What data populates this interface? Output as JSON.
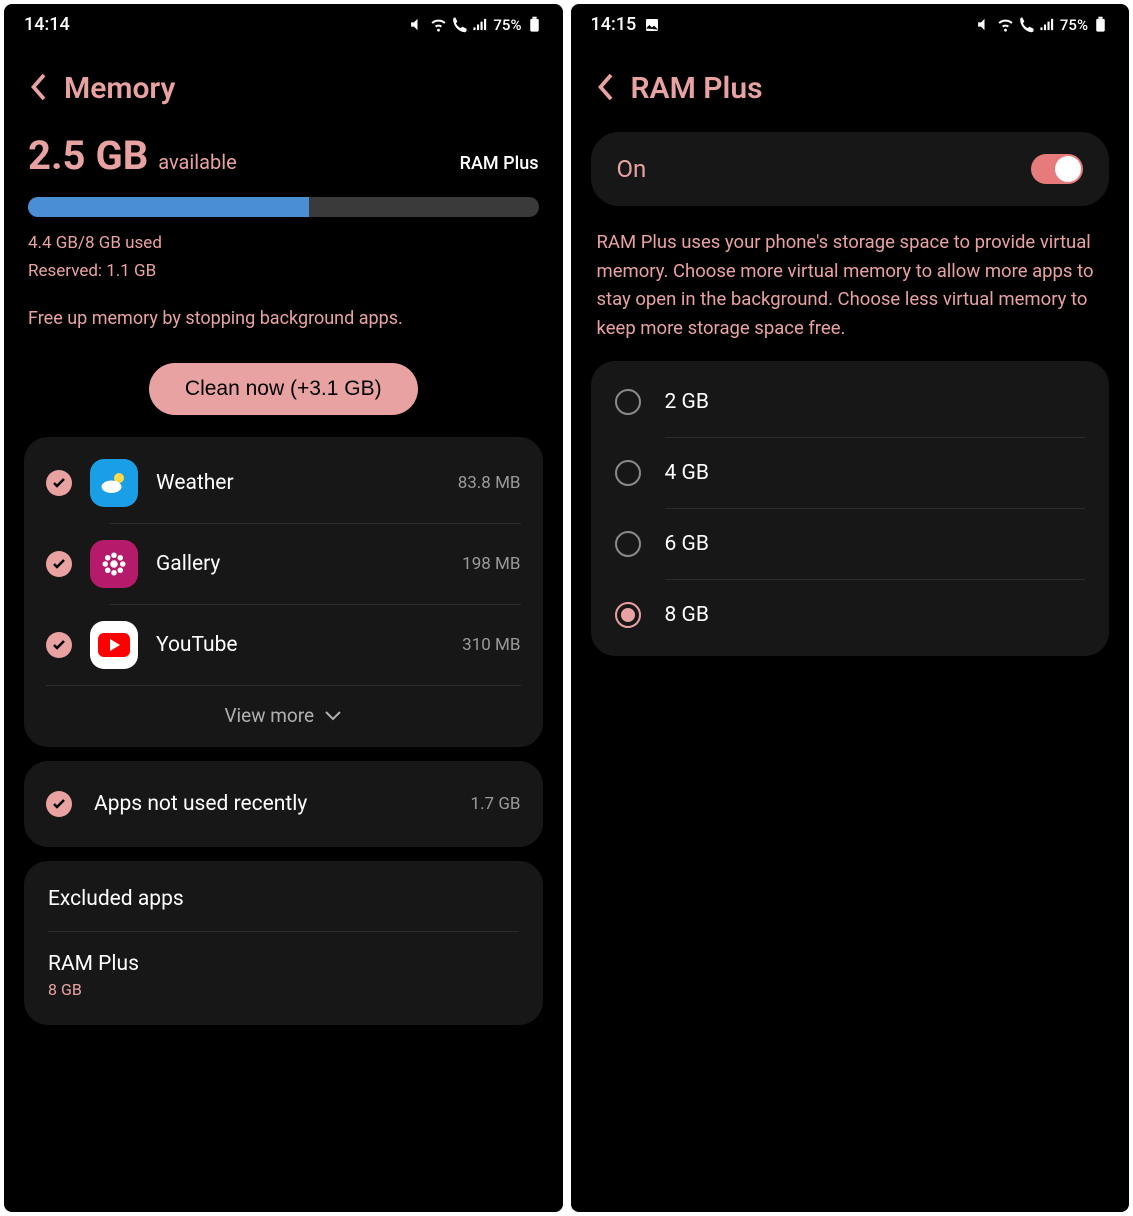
{
  "left": {
    "status": {
      "time": "14:14",
      "battery": "75%"
    },
    "header": {
      "title": "Memory"
    },
    "mem": {
      "big": "2.5 GB",
      "available": "available",
      "ramplus_link": "RAM Plus",
      "used": "4.4 GB/8 GB used",
      "reserved": "Reserved: 1.1 GB",
      "bar_pct": 55,
      "hint": "Free up memory by stopping background apps.",
      "clean_btn": "Clean now (+3.1 GB)"
    },
    "apps": {
      "items": [
        {
          "name": "Weather",
          "size": "83.8 MB",
          "icon": "weather"
        },
        {
          "name": "Gallery",
          "size": "198 MB",
          "icon": "gallery"
        },
        {
          "name": "YouTube",
          "size": "310 MB",
          "icon": "youtube"
        }
      ],
      "view_more": "View more"
    },
    "recent": {
      "title": "Apps not used recently",
      "size": "1.7 GB"
    },
    "excluded": {
      "title": "Excluded apps"
    },
    "ramplus": {
      "title": "RAM Plus",
      "value": "8 GB"
    }
  },
  "right": {
    "status": {
      "time": "14:15",
      "battery": "75%"
    },
    "header": {
      "title": "RAM Plus"
    },
    "toggle": {
      "label": "On",
      "on": true
    },
    "desc": "RAM Plus uses your phone's storage space to provide virtual memory. Choose more virtual memory to allow more apps to stay open in the background. Choose less virtual memory to keep more storage space free.",
    "options": [
      {
        "label": "2 GB",
        "selected": false
      },
      {
        "label": "4 GB",
        "selected": false
      },
      {
        "label": "6 GB",
        "selected": false
      },
      {
        "label": "8 GB",
        "selected": true
      }
    ]
  }
}
